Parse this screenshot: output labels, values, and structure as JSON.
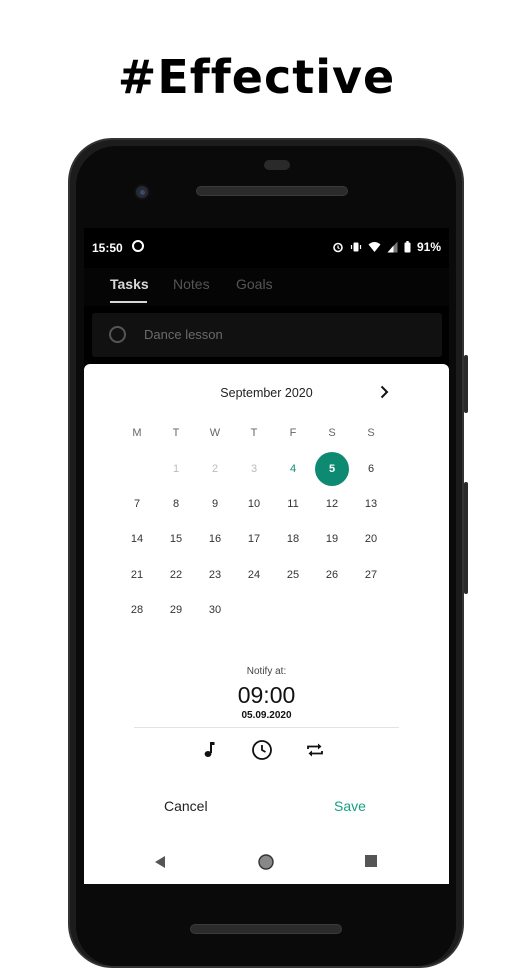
{
  "headline": "#Effective",
  "status": {
    "time": "15:50",
    "battery": "91%"
  },
  "tabs": [
    {
      "label": "Tasks"
    },
    {
      "label": "Notes"
    },
    {
      "label": "Goals"
    }
  ],
  "task": {
    "label": "Dance lesson"
  },
  "calendar": {
    "month": "September 2020",
    "weekdays": [
      "M",
      "T",
      "W",
      "T",
      "F",
      "S",
      "S"
    ],
    "weeks": [
      [
        "",
        "1",
        "2",
        "3",
        "4",
        "5",
        "6"
      ],
      [
        "7",
        "8",
        "9",
        "10",
        "11",
        "12",
        "13"
      ],
      [
        "14",
        "15",
        "16",
        "17",
        "18",
        "19",
        "20"
      ],
      [
        "21",
        "22",
        "23",
        "24",
        "25",
        "26",
        "27"
      ],
      [
        "28",
        "29",
        "30",
        "",
        "",
        "",
        ""
      ]
    ],
    "disabled_days": [
      "1",
      "2",
      "3"
    ],
    "today": "4",
    "selected": "5"
  },
  "notify": {
    "label": "Notify at:",
    "time": "09:00",
    "date": "05.09.2020"
  },
  "actions": {
    "cancel": "Cancel",
    "save": "Save"
  },
  "icons": [
    "music-note-icon",
    "clock-icon",
    "repeat-icon"
  ],
  "colors": {
    "accent": "#0e8a73",
    "save_text": "#16a085"
  }
}
